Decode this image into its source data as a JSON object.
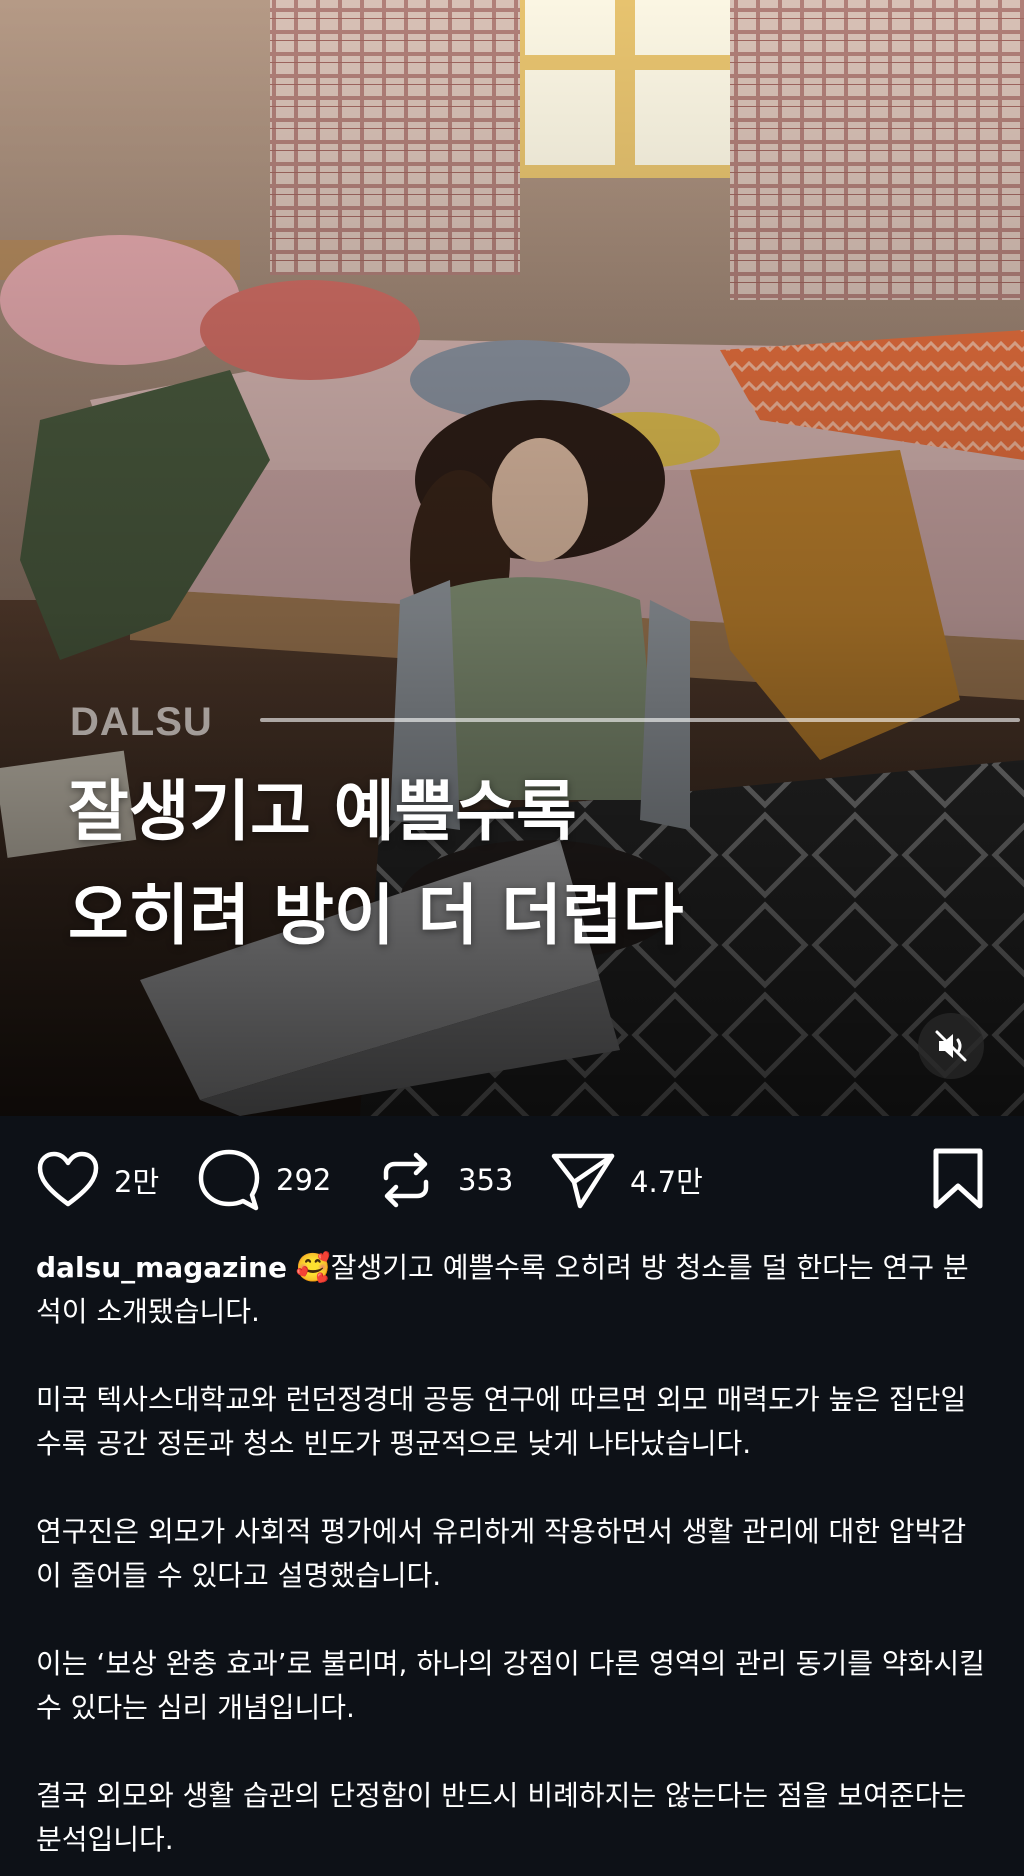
{
  "post": {
    "brand_overlay": "DALSU",
    "headline_lines": [
      "잘생기고 예쁠수록",
      "오히려 방이 더 더럽다"
    ],
    "mute_icon": "speaker-muted-icon"
  },
  "actions": {
    "like": {
      "icon": "heart-icon",
      "count": "2만"
    },
    "comment": {
      "icon": "comment-bubble-icon",
      "count": "292"
    },
    "repost": {
      "icon": "repost-arrows-icon",
      "count": "353"
    },
    "share": {
      "icon": "send-paper-plane-icon",
      "count": "4.7만"
    },
    "save": {
      "icon": "bookmark-icon"
    }
  },
  "caption": {
    "username": "dalsu_magazine",
    "emoji": "🥰",
    "paragraphs": [
      "잘생기고 예쁠수록 오히려 방 청소를 덜 한다는 연구 분석이 소개됐습니다.",
      "미국 텍사스대학교와 런던정경대 공동 연구에 따르면 외모 매력도가 높은 집단일수록 공간 정돈과 청소 빈도가 평균적으로 낮게 나타났습니다.",
      "연구진은 외모가 사회적 평가에서 유리하게 작용하면서 생활 관리에 대한 압박감이 줄어들 수 있다고 설명했습니다.",
      "이는 ‘보상 완충 효과’로 불리며, 하나의 강점이 다른 영역의 관리 동기를 약화시킬 수 있다는 심리 개념입니다.",
      "결국 외모와 생활 습관의 단정함이 반드시 비례하지는 않는다는 점을 보여준다는 분석입니다."
    ]
  },
  "colors": {
    "background": "#0d1117",
    "text": "#ffffff"
  }
}
